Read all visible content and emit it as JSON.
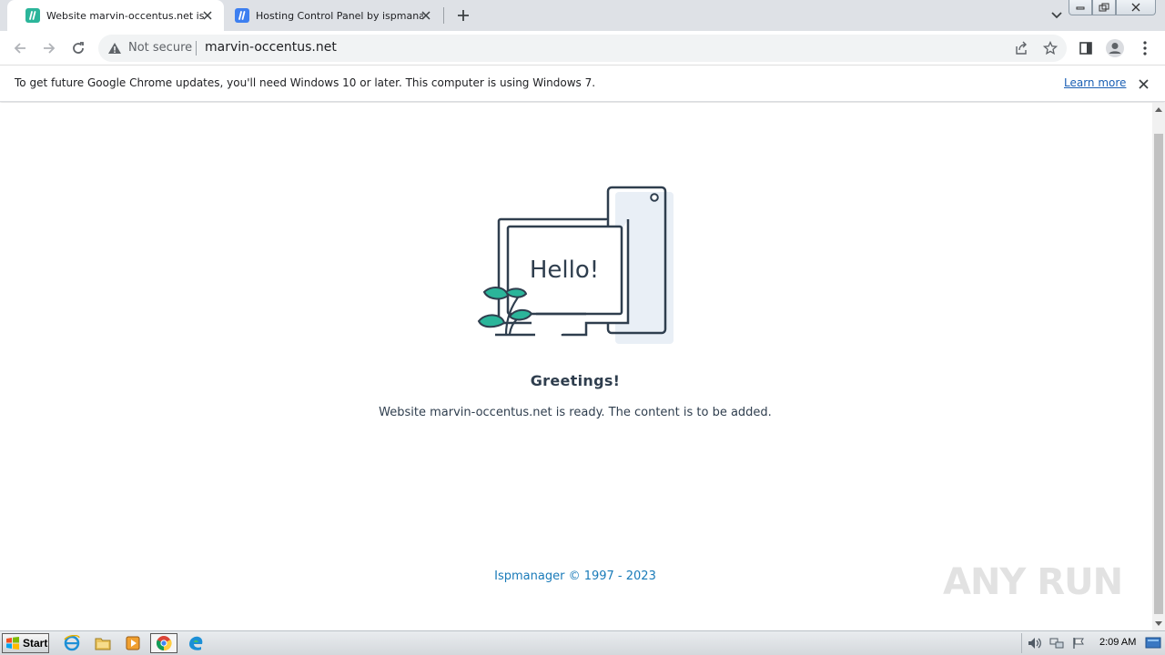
{
  "browser": {
    "tabs": [
      {
        "title": "Website marvin-occentus.net is ready",
        "favicon": "ispmanager-icon",
        "active": true
      },
      {
        "title": "Hosting Control Panel by ispmanager",
        "favicon": "ispmanager-icon",
        "active": false
      }
    ],
    "address": {
      "security_label": "Not secure",
      "url": "marvin-occentus.net"
    },
    "infobar": {
      "message": "To get future Google Chrome updates, you'll need Windows 10 or later. This computer is using Windows 7.",
      "link": "Learn more"
    }
  },
  "page": {
    "illustration_text": "Hello!",
    "heading": "Greetings!",
    "message": "Website marvin-occentus.net is ready. The content is to be added.",
    "footer": "Ispmanager © 1997 - 2023"
  },
  "watermark": {
    "text": "ANY RUN"
  },
  "taskbar": {
    "start_label": "Start",
    "clock": "2:09 AM"
  },
  "colors": {
    "accent_link": "#1a5fb4",
    "footer_link": "#1a7bb9",
    "text_dark": "#2f3e4e",
    "leaf_green": "#2bb59a"
  }
}
